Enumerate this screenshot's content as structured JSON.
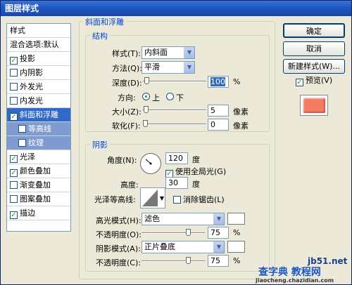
{
  "window": {
    "title": "图层样式"
  },
  "sidebar": {
    "header": "样式",
    "blend_options": "混合选项:默认",
    "items": [
      {
        "label": "投影",
        "checked": true
      },
      {
        "label": "内阴影",
        "checked": false
      },
      {
        "label": "外发光",
        "checked": false
      },
      {
        "label": "内发光",
        "checked": false
      },
      {
        "label": "斜面和浮雕",
        "checked": true
      },
      {
        "label": "等高线",
        "checked": false
      },
      {
        "label": "纹理",
        "checked": false
      },
      {
        "label": "光泽",
        "checked": true
      },
      {
        "label": "颜色叠加",
        "checked": true
      },
      {
        "label": "渐变叠加",
        "checked": false
      },
      {
        "label": "图案叠加",
        "checked": false
      },
      {
        "label": "描边",
        "checked": true
      }
    ]
  },
  "bevel": {
    "section_title": "斜面和浮雕",
    "structure_title": "结构",
    "style_label": "样式(T):",
    "style_value": "内斜面",
    "technique_label": "方法(Q):",
    "technique_value": "平滑",
    "depth_label": "深度(D):",
    "depth_value": "100",
    "depth_unit": "%",
    "direction_label": "方向:",
    "dir_up": "上",
    "dir_down": "下",
    "size_label": "大小(Z):",
    "size_value": "5",
    "size_unit": "像素",
    "soften_label": "软化(F):",
    "soften_value": "0",
    "soften_unit": "像素"
  },
  "shading": {
    "title": "阴影",
    "angle_label": "角度(N):",
    "angle_value": "120",
    "angle_unit": "度",
    "global_light_label": "使用全局光(G)",
    "altitude_label": "高度:",
    "altitude_value": "30",
    "altitude_unit": "度",
    "gloss_label": "光泽等高线:",
    "antialias_label": "消除锯齿(L)",
    "highlight_mode_label": "高光模式(H):",
    "highlight_mode_value": "滤色",
    "highlight_opacity_label": "不透明度(O):",
    "highlight_opacity_value": "75",
    "highlight_opacity_unit": "%",
    "shadow_mode_label": "阴影模式(A):",
    "shadow_mode_value": "正片叠底",
    "shadow_opacity_label": "不透明度(C):",
    "shadow_opacity_value": "75",
    "shadow_opacity_unit": "%"
  },
  "buttons": {
    "ok": "确定",
    "cancel": "取消",
    "new_style": "新建样式(W)...",
    "preview": "预览(V)"
  },
  "watermark": {
    "line1": "jb51.net",
    "line2": "查字典 教程网",
    "line3": "jiaocheng.chazidian.com"
  },
  "colors": {
    "accent": "#3169c6",
    "title_bar": "#1f57c2",
    "preview": "#f47c62"
  }
}
